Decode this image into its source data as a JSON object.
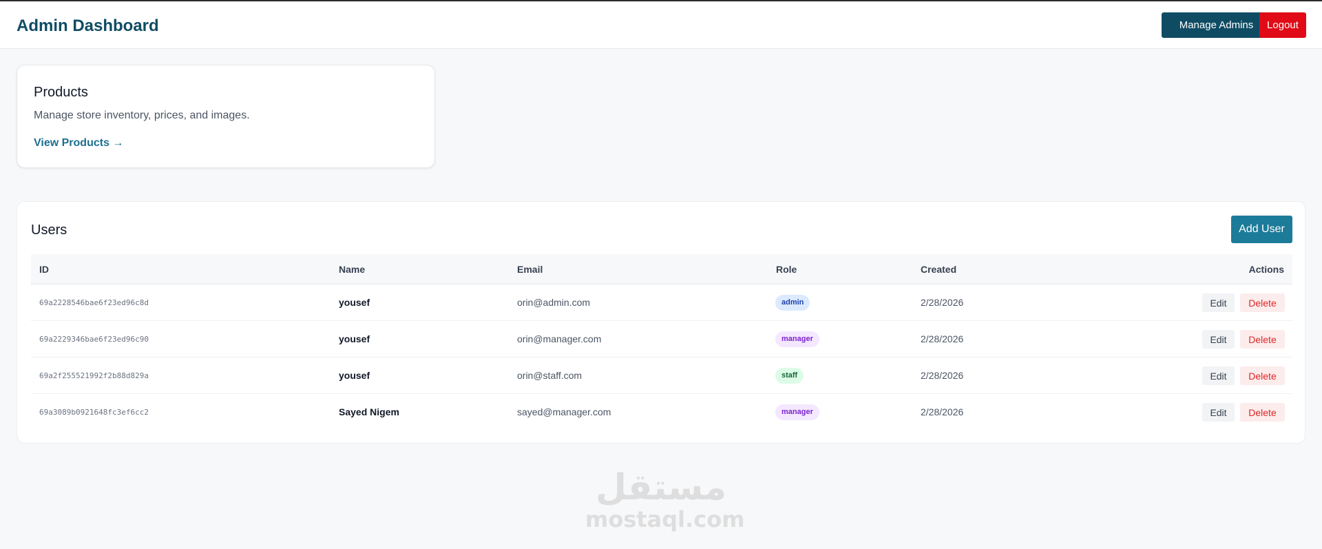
{
  "header": {
    "title": "Admin Dashboard",
    "manage_admins_label": "Manage Admins",
    "logout_label": "Logout"
  },
  "products_card": {
    "title": "Products",
    "description": "Manage store inventory, prices, and images.",
    "link_label": "View Products →"
  },
  "users": {
    "title": "Users",
    "add_user_label": "Add User",
    "columns": [
      "ID",
      "Name",
      "Email",
      "Role",
      "Created",
      "Actions"
    ],
    "rows": [
      {
        "id": "69a2228546bae6f23ed96c8d",
        "name": "yousef",
        "email": "orin@admin.com",
        "role": "admin",
        "created": "2/28/2026"
      },
      {
        "id": "69a2229346bae6f23ed96c90",
        "name": "yousef",
        "email": "orin@manager.com",
        "role": "manager",
        "created": "2/28/2026"
      },
      {
        "id": "69a2f255521992f2b88d829a",
        "name": "yousef",
        "email": "orin@staff.com",
        "role": "staff",
        "created": "2/28/2026"
      },
      {
        "id": "69a3089b0921648fc3ef6cc2",
        "name": "Sayed Nigem",
        "email": "sayed@manager.com",
        "role": "manager",
        "created": "2/28/2026"
      }
    ],
    "edit_label": "Edit",
    "delete_label": "Delete"
  },
  "watermark": {
    "arabic": "مستقل",
    "latin": "mostaql.com"
  },
  "colors": {
    "brand": "#0f4c64",
    "accent": "#1c7b99",
    "danger": "#e00b16"
  }
}
